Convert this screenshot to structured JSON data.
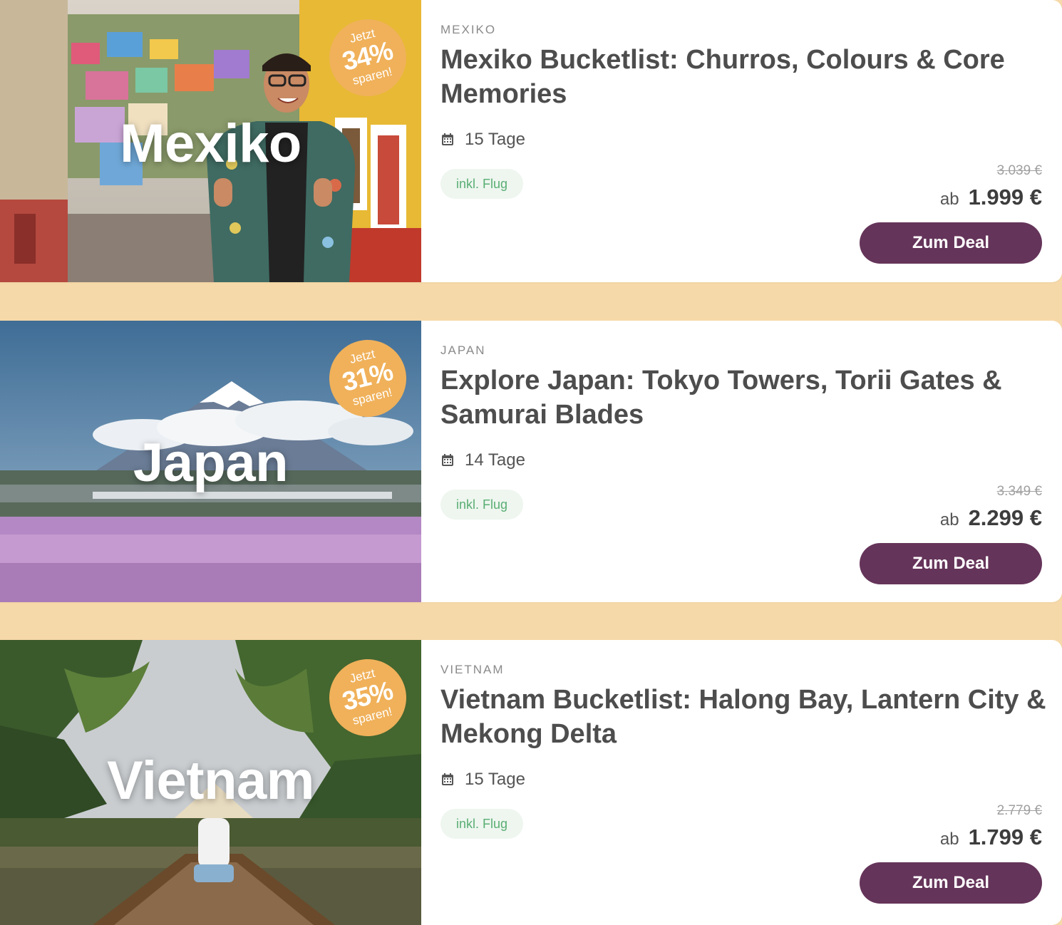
{
  "deals": [
    {
      "destination": "Mexiko",
      "badge": {
        "top": "Jetzt",
        "percent": "34%",
        "bottom": "sparen!"
      },
      "country": "MEXIKO",
      "title": "Mexiko Bucketlist: Churros, Colours & Core Memories",
      "duration": "15 Tage",
      "tag": "inkl. Flug",
      "old_price": "3.039 €",
      "price_prefix": "ab",
      "price": "1.999 €",
      "button": "Zum Deal"
    },
    {
      "destination": "Japan",
      "badge": {
        "top": "Jetzt",
        "percent": "31%",
        "bottom": "sparen!"
      },
      "country": "JAPAN",
      "title": "Explore Japan: Tokyo Towers, Torii Gates & Samurai Blades",
      "duration": "14 Tage",
      "tag": "inkl. Flug",
      "old_price": "3.349 €",
      "price_prefix": "ab",
      "price": "2.299 €",
      "button": "Zum Deal"
    },
    {
      "destination": "Vietnam",
      "badge": {
        "top": "Jetzt",
        "percent": "35%",
        "bottom": "sparen!"
      },
      "country": "VIETNAM",
      "title": "Vietnam Bucketlist: Halong Bay, Lantern City & Mekong Delta",
      "duration": "15 Tage",
      "tag": "inkl. Flug",
      "old_price": "2.779 €",
      "price_prefix": "ab",
      "price": "1.799 €",
      "button": "Zum Deal"
    }
  ],
  "colors": {
    "page_background": "#f6d9a9",
    "badge": "#f0b15a",
    "button": "#65345a",
    "tag_background": "#eef6ef",
    "tag_text": "#5aae74"
  },
  "icons": [
    "calendar-icon"
  ]
}
